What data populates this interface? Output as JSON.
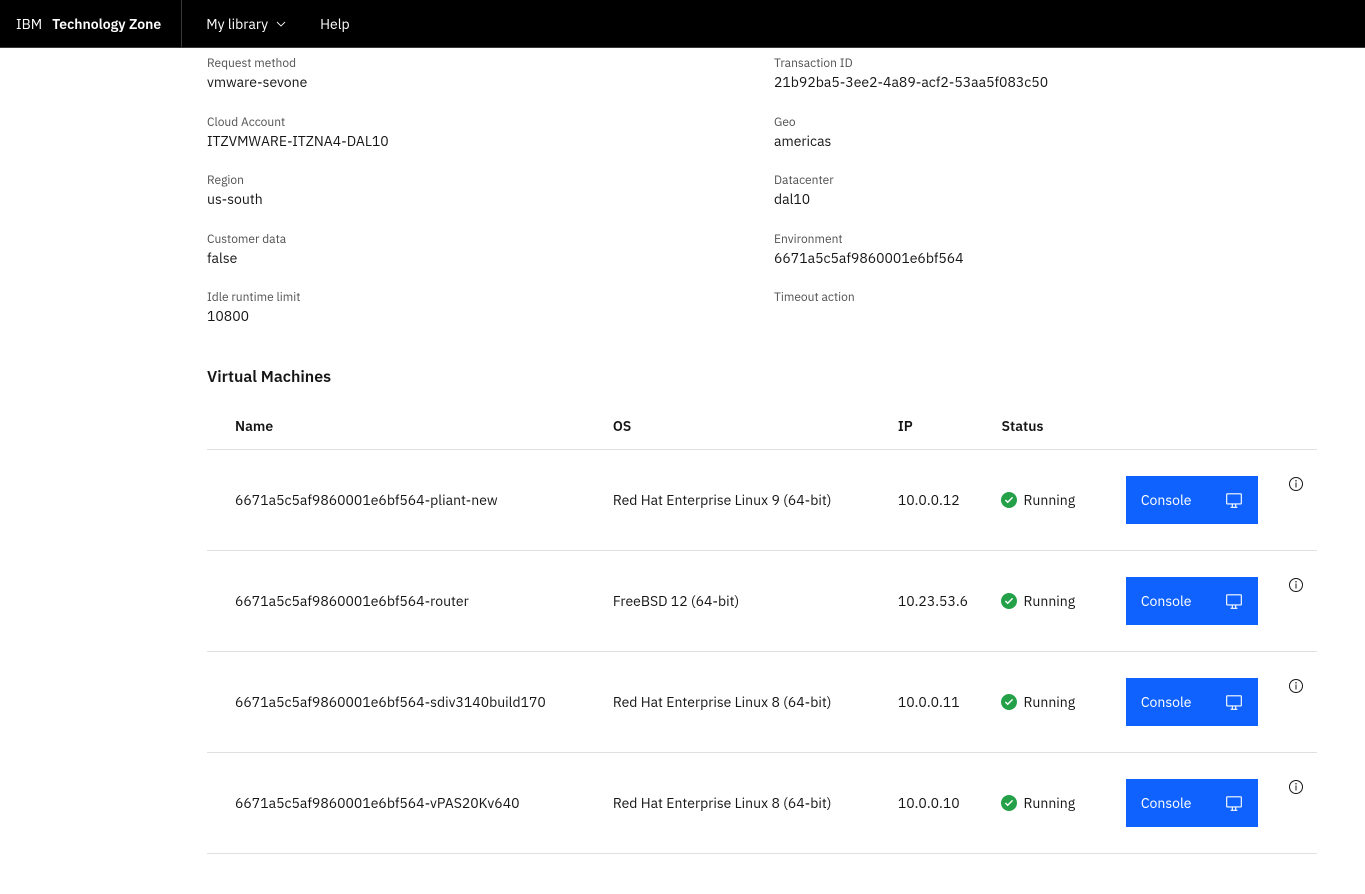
{
  "header": {
    "brand_prefix": "IBM",
    "brand_product": "Technology Zone",
    "nav": {
      "my_library": "My library",
      "help": "Help"
    }
  },
  "details": {
    "request_method": {
      "label": "Request method",
      "value": "vmware-sevone"
    },
    "transaction_id": {
      "label": "Transaction ID",
      "value": "21b92ba5-3ee2-4a89-acf2-53aa5f083c50"
    },
    "cloud_account": {
      "label": "Cloud Account",
      "value": "ITZVMWARE-ITZNA4-DAL10"
    },
    "geo": {
      "label": "Geo",
      "value": "americas"
    },
    "region": {
      "label": "Region",
      "value": "us-south"
    },
    "datacenter": {
      "label": "Datacenter",
      "value": "dal10"
    },
    "customer_data": {
      "label": "Customer data",
      "value": "false"
    },
    "environment": {
      "label": "Environment",
      "value": "6671a5c5af9860001e6bf564"
    },
    "idle_runtime_limit": {
      "label": "Idle runtime limit",
      "value": "10800"
    },
    "timeout_action": {
      "label": "Timeout action",
      "value": ""
    }
  },
  "vm_section": {
    "title": "Virtual Machines",
    "columns": {
      "name": "Name",
      "os": "OS",
      "ip": "IP",
      "status": "Status"
    },
    "console_label": "Console",
    "rows": [
      {
        "name": "6671a5c5af9860001e6bf564-pliant-new",
        "os": "Red Hat Enterprise Linux 9 (64-bit)",
        "ip": "10.0.0.12",
        "status": "Running"
      },
      {
        "name": "6671a5c5af9860001e6bf564-router",
        "os": "FreeBSD 12 (64-bit)",
        "ip": "10.23.53.6",
        "status": "Running"
      },
      {
        "name": "6671a5c5af9860001e6bf564-sdiv3140build170",
        "os": "Red Hat Enterprise Linux 8 (64-bit)",
        "ip": "10.0.0.11",
        "status": "Running"
      },
      {
        "name": "6671a5c5af9860001e6bf564-vPAS20Kv640",
        "os": "Red Hat Enterprise Linux 8 (64-bit)",
        "ip": "10.0.0.10",
        "status": "Running"
      }
    ]
  }
}
